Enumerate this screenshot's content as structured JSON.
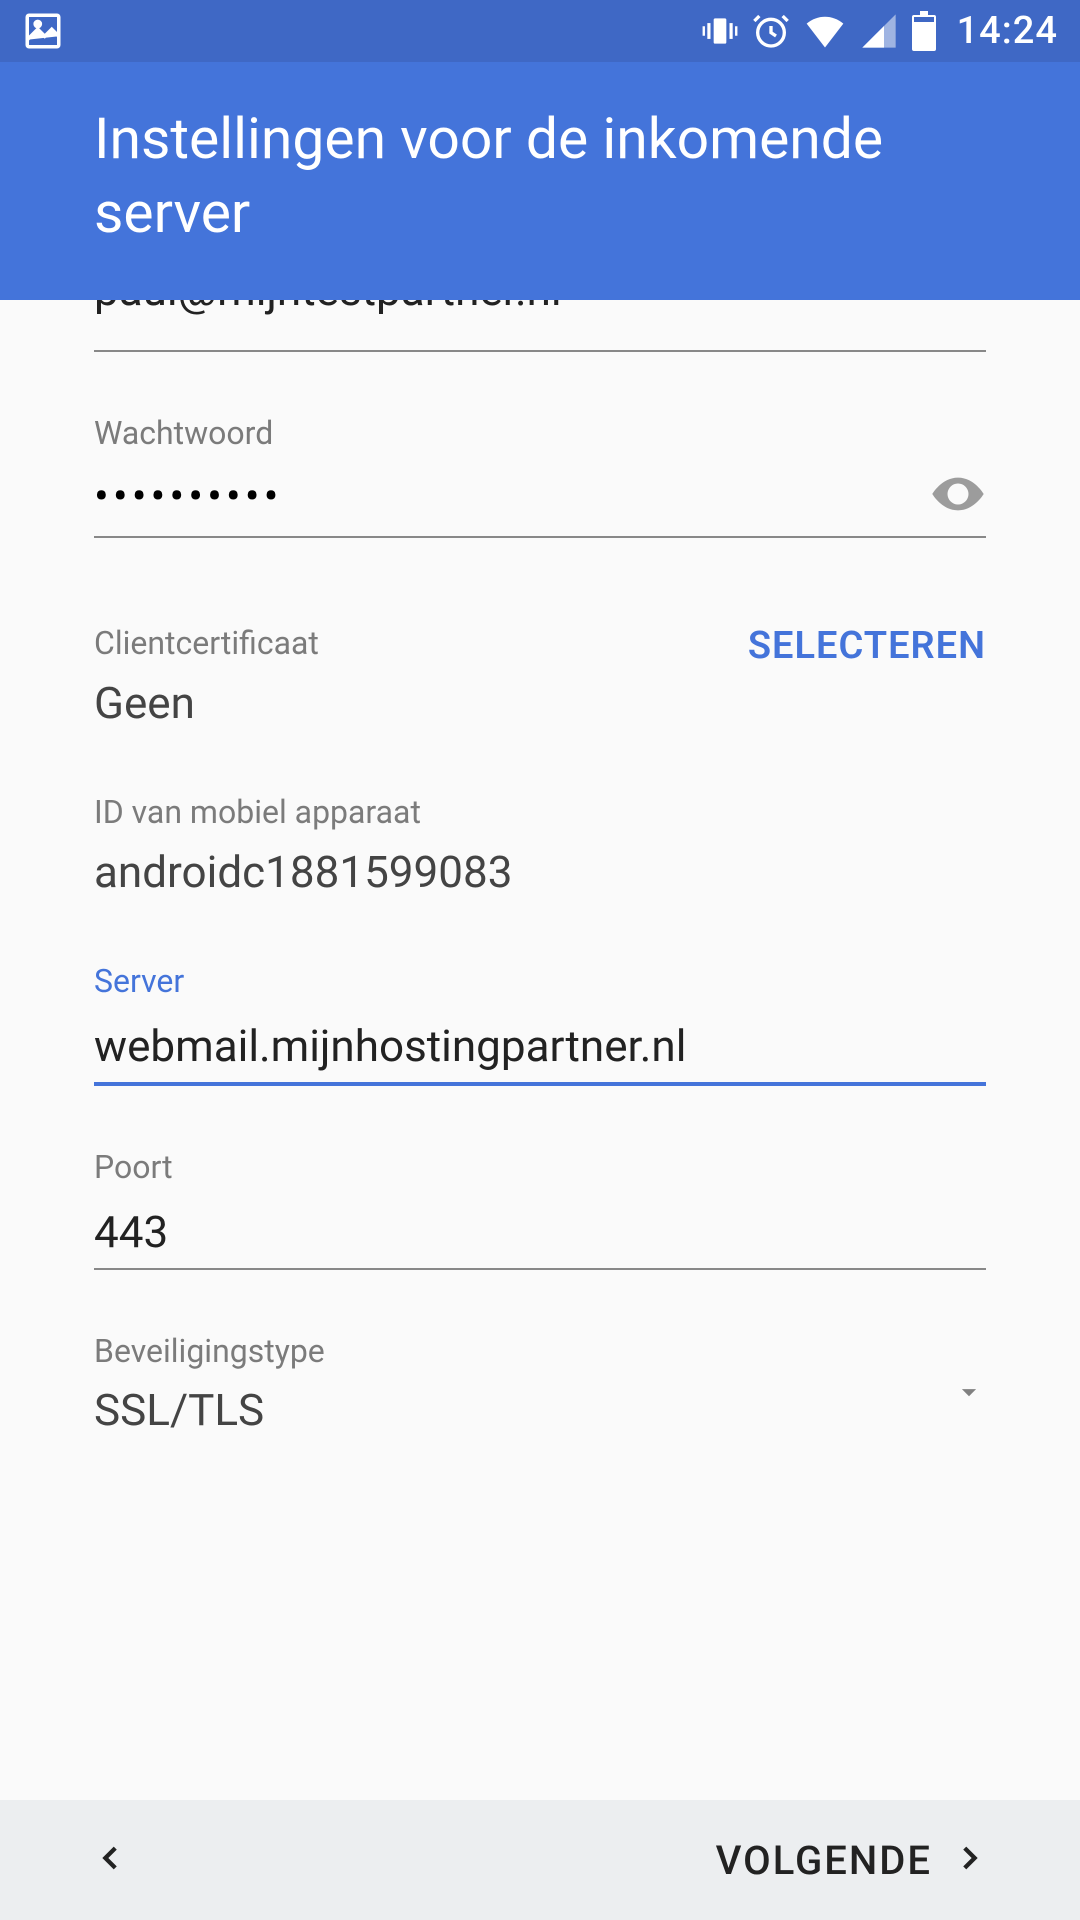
{
  "status": {
    "time": "14:24"
  },
  "header": {
    "title": "Instellingen voor de inkomende server"
  },
  "form": {
    "email_value": "paul@mijntestpartner.nl",
    "password_label": "Wachtwoord",
    "password_masked": "••••••••••",
    "cert_label": "Clientcertificaat",
    "cert_value": "Geen",
    "cert_button": "SELECTEREN",
    "device_id_label": "ID van mobiel apparaat",
    "device_id_value": "androidc1881599083",
    "server_label": "Server",
    "server_value": "webmail.mijnhostingpartner.nl",
    "port_label": "Poort",
    "port_value": "443",
    "security_label": "Beveiligingstype",
    "security_value": "SSL/TLS"
  },
  "footer": {
    "next": "VOLGENDE"
  }
}
